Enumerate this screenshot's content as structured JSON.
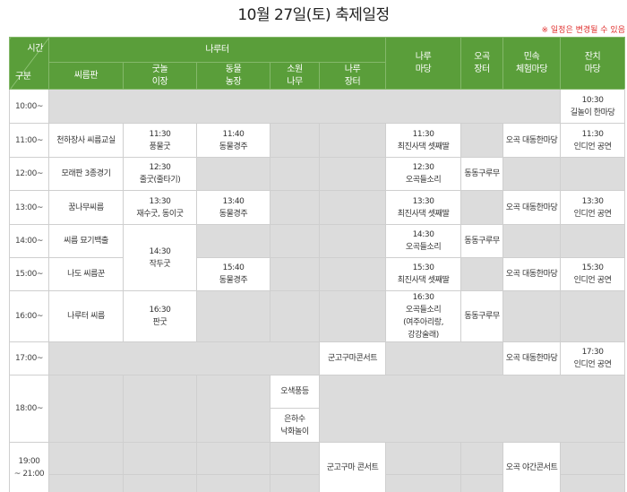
{
  "title": "10월 27일(토) 축제일정",
  "note": "※ 일정은 변경될 수 있음",
  "header": {
    "time": "시간",
    "group": "구분",
    "naruteo": "나루터",
    "ssireum": "씨름판",
    "gut": [
      "굿놀",
      "이장"
    ],
    "animal": [
      "동물",
      "농장"
    ],
    "wish": [
      "소원",
      "나무"
    ],
    "narujangteo": [
      "나루",
      "장터"
    ],
    "narumadang": [
      "나루",
      "마당"
    ],
    "ogokjangteo": [
      "오곡",
      "장터"
    ],
    "folk": [
      "민속",
      "체험마당"
    ],
    "party": [
      "잔치",
      "마당"
    ]
  },
  "rows": {
    "r10": {
      "time": "10:00~",
      "folk": [
        "10:30",
        "길놀이 한마당"
      ]
    },
    "r11": {
      "time": "11:00~",
      "ssireum": "천하장사 씨름교실",
      "gut": [
        "11:30",
        "풍물굿"
      ],
      "animal": [
        "11:40",
        "동물경주"
      ],
      "narumadang": [
        "11:30",
        "최진사댁 셋째딸"
      ],
      "folk": "오곡 대동한마당",
      "party": [
        "11:30",
        "인디언 공연"
      ]
    },
    "r12": {
      "time": "12:00~",
      "ssireum": "모래판 3종경기",
      "gut": [
        "12:30",
        "줄굿(줄타기)"
      ],
      "narumadang": [
        "12:30",
        "오곡들소리"
      ],
      "ogok": "동동구루무"
    },
    "r13": {
      "time": "13:00~",
      "ssireum": "꿈나무씨름",
      "gut": [
        "13:30",
        "재수굿, 동이굿"
      ],
      "animal": [
        "13:40",
        "동물경주"
      ],
      "narumadang": [
        "13:30",
        "최진사댁 셋째딸"
      ],
      "folk": "오곡 대동한마당",
      "party": [
        "13:30",
        "인디언 공연"
      ]
    },
    "r14": {
      "time": "14:00~",
      "ssireum": "씨름 묘기백출",
      "gut": [
        "14:30",
        "작두굿"
      ],
      "narumadang": [
        "14:30",
        "오곡들소리"
      ],
      "ogok": "동동구루무"
    },
    "r15": {
      "time": "15:00~",
      "ssireum": "나도 씨름꾼",
      "animal": [
        "15:40",
        "동물경주"
      ],
      "narumadang": [
        "15:30",
        "최진사댁 셋째딸"
      ],
      "folk": "오곡 대동한마당",
      "party": [
        "15:30",
        "인디언 공연"
      ]
    },
    "r16": {
      "time": "16:00~",
      "ssireum": "나루터 씨름",
      "gut": [
        "16:30",
        "판굿"
      ],
      "narumadang": [
        "16:30",
        "오곡들소리",
        "(여주아리랑,",
        "강강술래)"
      ],
      "ogok": "동동구루무"
    },
    "r17": {
      "time": "17:00~",
      "narujangteo": "군고구마콘서트",
      "folk": "오곡 대동한마당",
      "party": [
        "17:30",
        "인디언 공연"
      ]
    },
    "r18": {
      "time": "18:00~",
      "wish1": "오색풍등",
      "wish2": [
        "은하수",
        "낙화놀이"
      ]
    },
    "r19": {
      "time": [
        "19:00",
        "~ 21:00"
      ],
      "narujangteo": "군고구마 콘서트",
      "folk": "오곡 야간콘서트"
    }
  }
}
